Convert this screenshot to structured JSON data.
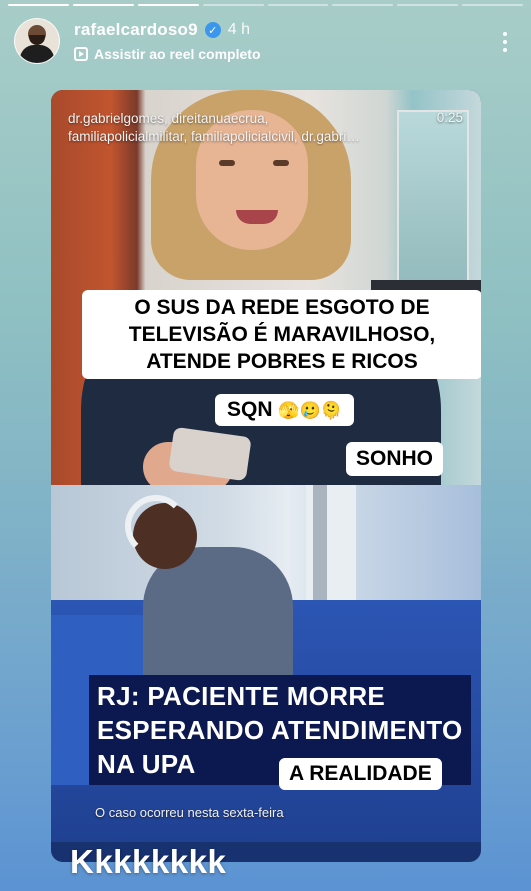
{
  "story": {
    "progress_segments": 8,
    "completed_segments": 3
  },
  "header": {
    "username": "rafaelcardoso9",
    "time": "4 h",
    "reel_link": "Assistir ao reel completo",
    "verified_icon": "verified-badge-icon",
    "more_icon": "more-options-icon"
  },
  "video": {
    "tags_line1": "dr.gabrielgomes, direitanuaecrua,",
    "tags_line2": "familiapolicialmilitar, familiapolicialcivil, dr.gabri…",
    "duration": "0:25",
    "caption_main": "O SUS DA REDE ESGOTO DE TELEVISÃO É MARAVILHOSO, ATENDE POBRES E RICOS",
    "caption_sqn": "SQN",
    "caption_emojis": "🫣🥲🫠",
    "label_sonho": "SONHO",
    "news_line1": "RJ: PACIENTE MORRE",
    "news_line2": "ESPERANDO ATENDIMENTO",
    "news_line3": "NA UPA",
    "label_realidade": "A REALIDADE",
    "news_subtitle": "O caso ocorreu nesta sexta-feira"
  },
  "reply": {
    "text": "Kkkkkkkk"
  },
  "colors": {
    "verified": "#3b97ec",
    "news_box": "#0c1850"
  }
}
